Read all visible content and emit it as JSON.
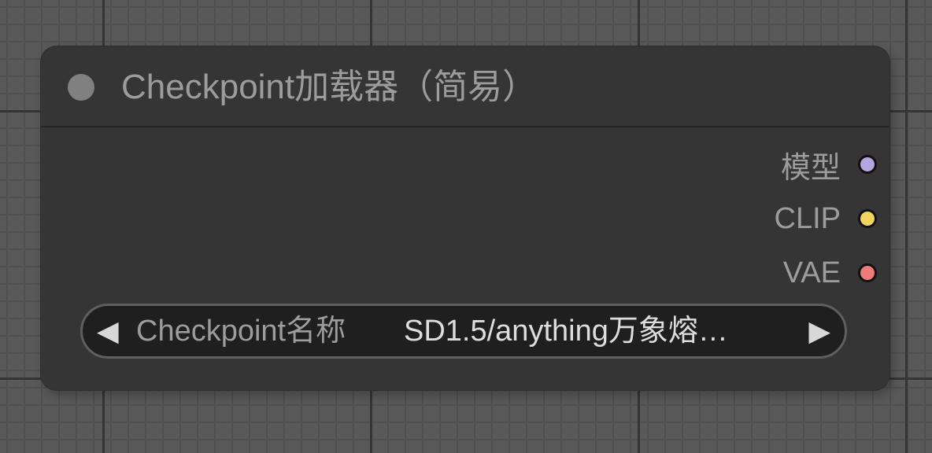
{
  "node": {
    "title": "Checkpoint加载器（简易）",
    "outputs": [
      {
        "label": "模型",
        "color": "#b3a5e0"
      },
      {
        "label": "CLIP",
        "color": "#f3d45a"
      },
      {
        "label": "VAE",
        "color": "#f07a7a"
      }
    ],
    "widget": {
      "label": "Checkpoint名称",
      "value": "SD1.5/anything万象熔…",
      "left_arrow": "◀",
      "right_arrow": "▶"
    }
  }
}
